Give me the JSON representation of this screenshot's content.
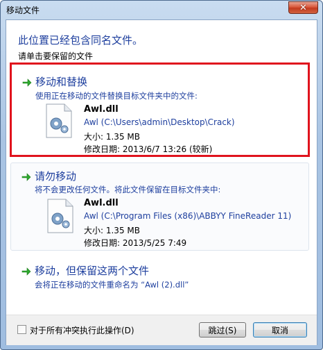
{
  "window": {
    "title": "移动文件",
    "close_label": "✕"
  },
  "heading": "此位置已经包含同名文件。",
  "subheading": "请单击要保留的文件",
  "options": [
    {
      "title": "移动和替换",
      "desc": "使用正在移动的文件替换目标文件夹中的文件:",
      "file": {
        "name": "Awl.dll",
        "path": "Awl (C:\\Users\\admin\\Desktop\\Crack)",
        "size": "大小: 1.35 MB",
        "modified": "修改日期: 2013/6/7 13:26 (较新)"
      }
    },
    {
      "title": "请勿移动",
      "desc": "将不会更改任何文件。将此文件保留在目标文件夹中:",
      "file": {
        "name": "Awl.dll",
        "path": "Awl (C:\\Program Files (x86)\\ABBYY FineReader 11)",
        "size": "大小: 1.35 MB",
        "modified": "修改日期: 2013/5/25 7:49"
      }
    },
    {
      "title": "移动，但保留这两个文件",
      "desc": "会将正在移动的文件重命名为 “Awl (2).dll”"
    }
  ],
  "footer": {
    "checkbox_label": "对于所有冲突执行此操作(D)",
    "skip_label": "跳过(S)",
    "cancel_label": "取消"
  },
  "colors": {
    "accent": "#1e3f9e",
    "highlight_border": "#e0131d",
    "arrow": "#2eaa2e"
  },
  "icons": [
    "close-icon",
    "green-arrow-icon",
    "dll-file-icon",
    "checkbox-icon"
  ]
}
